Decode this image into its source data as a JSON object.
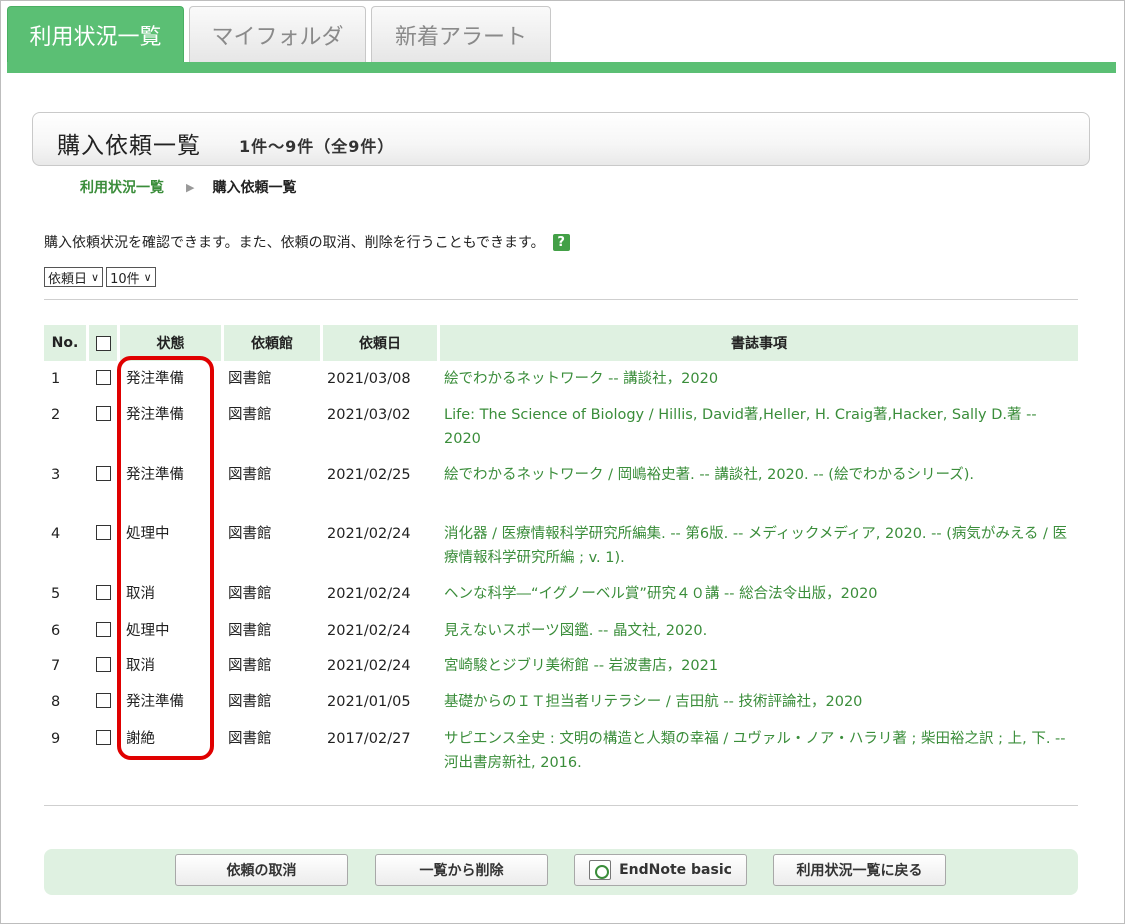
{
  "tabs": [
    {
      "label": "利用状況一覧",
      "active": true
    },
    {
      "label": "マイフォルダ",
      "active": false
    },
    {
      "label": "新着アラート",
      "active": false
    }
  ],
  "title": {
    "main": "購入依頼一覧",
    "count": "1件～9件（全9件）"
  },
  "breadcrumb": {
    "parent": "利用状況一覧",
    "current": "購入依頼一覧"
  },
  "description": "購入依頼状況を確認できます。また、依頼の取消、削除を行うこともできます。",
  "help_icon": "?",
  "sort_select": "依頼日",
  "count_select": "10件",
  "columns": {
    "no": "No.",
    "status": "状態",
    "library": "依頼館",
    "date": "依頼日",
    "biblio": "書誌事項"
  },
  "rows": [
    {
      "no": "1",
      "status": "発注準備",
      "library": "図書館",
      "date": "2021/03/08",
      "biblio": "絵でわかるネットワーク -- 講談社，2020"
    },
    {
      "no": "2",
      "status": "発注準備",
      "library": "図書館",
      "date": "2021/03/02",
      "biblio": "Life: The Science of Biology / Hillis, David著,Heller, H. Craig著,Hacker, Sally D.著 -- 2020"
    },
    {
      "no": "3",
      "status": "発注準備",
      "library": "図書館",
      "date": "2021/02/25",
      "biblio": "絵でわかるネットワーク / 岡嶋裕史著. -- 講談社, 2020. -- (絵でわかるシリーズ)."
    },
    {
      "no": "4",
      "status": "処理中",
      "library": "図書館",
      "date": "2021/02/24",
      "biblio": "消化器 / 医療情報科学研究所編集. -- 第6版. -- メディックメディア, 2020. -- (病気がみえる / 医療情報科学研究所編 ; v. 1)."
    },
    {
      "no": "5",
      "status": "取消",
      "library": "図書館",
      "date": "2021/02/24",
      "biblio": "ヘンな科学―“イグノーベル賞”研究４０講 -- 総合法令出版，2020"
    },
    {
      "no": "6",
      "status": "処理中",
      "library": "図書館",
      "date": "2021/02/24",
      "biblio": "見えないスポーツ図鑑. -- 晶文社, 2020."
    },
    {
      "no": "7",
      "status": "取消",
      "library": "図書館",
      "date": "2021/02/24",
      "biblio": "宮崎駿とジブリ美術館 -- 岩波書店，2021"
    },
    {
      "no": "8",
      "status": "発注準備",
      "library": "図書館",
      "date": "2021/01/05",
      "biblio": "基礎からのＩＴ担当者リテラシー / 吉田航 -- 技術評論社，2020"
    },
    {
      "no": "9",
      "status": "謝絶",
      "library": "図書館",
      "date": "2017/02/27",
      "biblio": "サピエンス全史 : 文明の構造と人類の幸福 / ユヴァル・ノア・ハラリ著 ; 柴田裕之訳 ; 上, 下. -- 河出書房新社, 2016."
    }
  ],
  "buttons": {
    "cancel": "依頼の取消",
    "delete": "一覧から削除",
    "endnote": "EndNote basic",
    "back": "利用状況一覧に戻る"
  },
  "colors": {
    "accent": "#5bbf74",
    "link": "#3a8d3a",
    "header_bg": "#dff1e1",
    "highlight": "#e00000"
  }
}
